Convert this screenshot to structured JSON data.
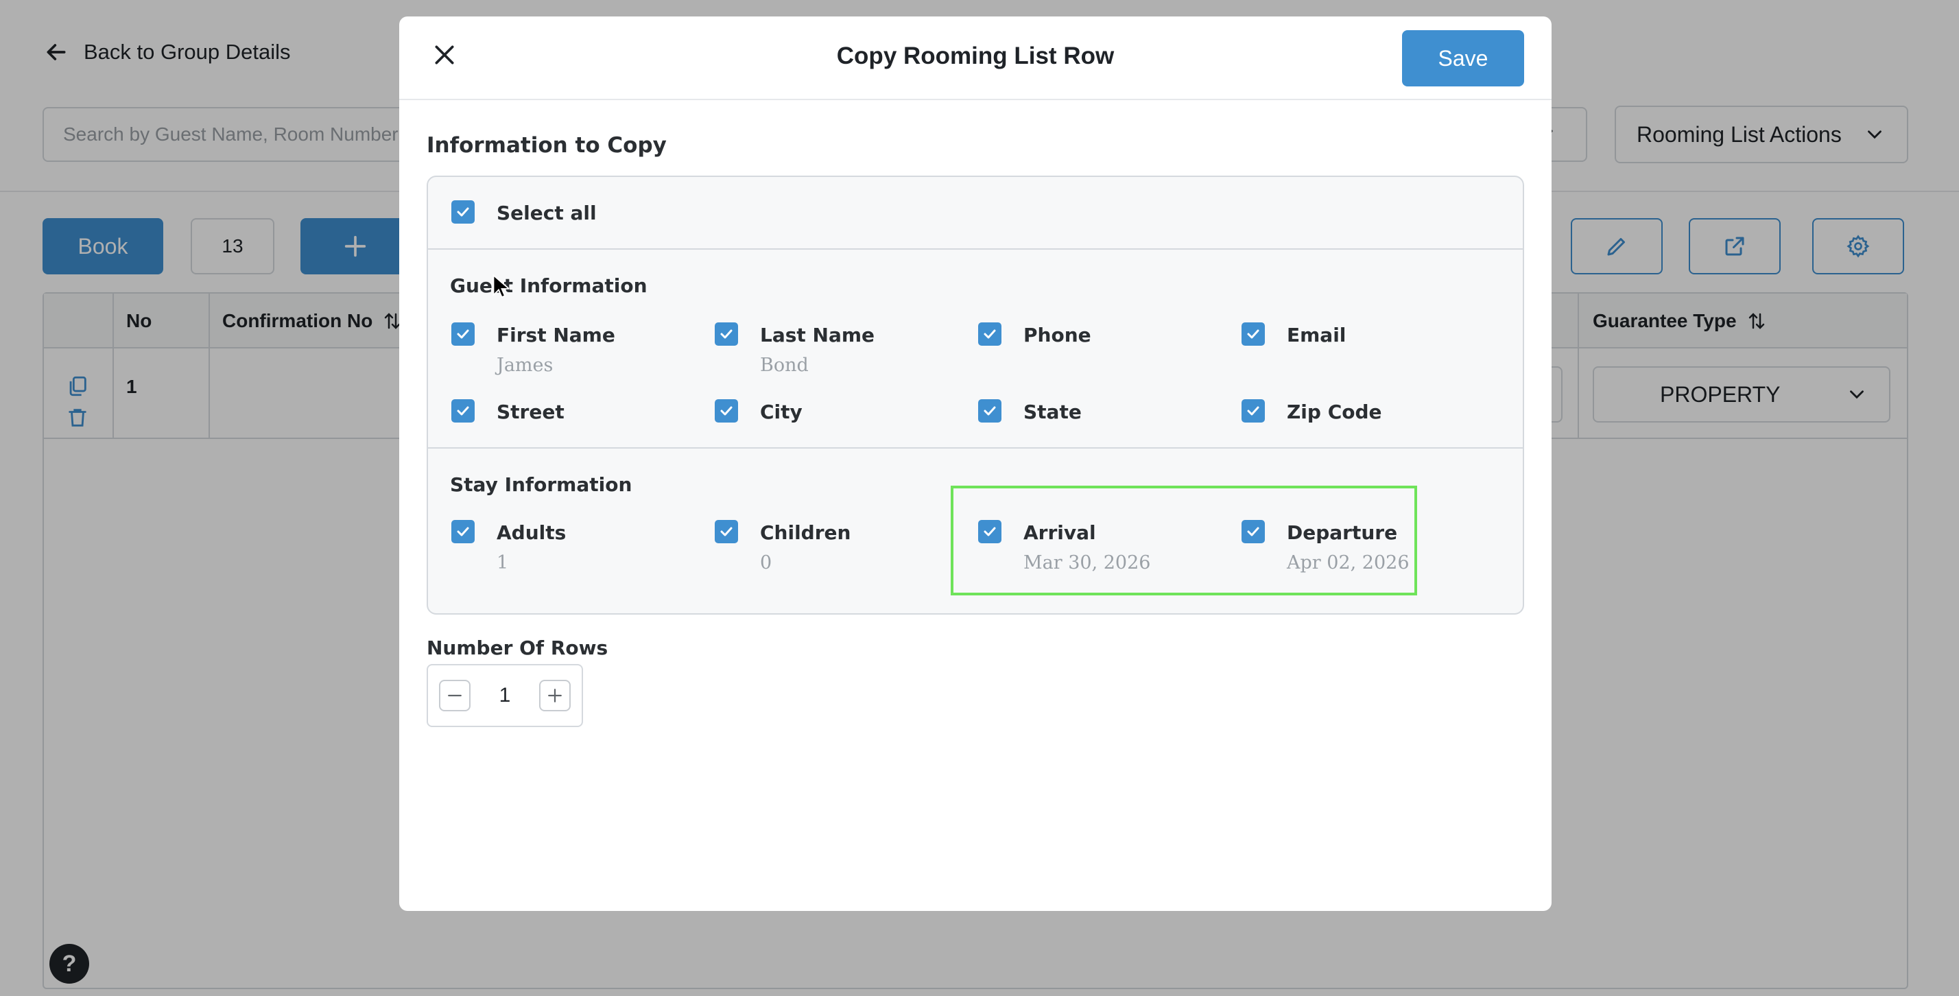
{
  "background": {
    "back_link": "Back to Group Details",
    "search_placeholder": "Search by Guest Name, Room Number",
    "actions_select": "Rooming List Actions",
    "book_button": "Book",
    "count": "13",
    "table": {
      "headers": [
        "No",
        "Confirmation No",
        "Guarantee Type"
      ],
      "row_number": "1",
      "guarantee_value": "PROPERTY"
    },
    "help": "?"
  },
  "modal": {
    "title": "Copy Rooming List Row",
    "save_label": "Save",
    "section_title": "Information to Copy",
    "select_all": "Select all",
    "guest_section": "Guest Information",
    "guest_fields": [
      {
        "label": "First Name",
        "value": "James",
        "checked": true
      },
      {
        "label": "Last Name",
        "value": "Bond",
        "checked": true
      },
      {
        "label": "Phone",
        "value": "",
        "checked": true
      },
      {
        "label": "Email",
        "value": "",
        "checked": true
      },
      {
        "label": "Street",
        "value": "",
        "checked": true
      },
      {
        "label": "City",
        "value": "",
        "checked": true
      },
      {
        "label": "State",
        "value": "",
        "checked": true
      },
      {
        "label": "Zip Code",
        "value": "",
        "checked": true
      }
    ],
    "stay_section": "Stay Information",
    "stay_fields": [
      {
        "label": "Adults",
        "value": "1",
        "checked": true
      },
      {
        "label": "Children",
        "value": "0",
        "checked": true
      },
      {
        "label": "Arrival",
        "value": "Mar 30, 2026",
        "checked": true
      },
      {
        "label": "Departure",
        "value": "Apr 02, 2026",
        "checked": true
      }
    ],
    "rows_label": "Number Of Rows",
    "rows_value": "1"
  },
  "colors": {
    "accent": "#3f8fd0",
    "highlight": "#6fe35a",
    "overlay": "rgba(0,0,0,0.31)"
  }
}
